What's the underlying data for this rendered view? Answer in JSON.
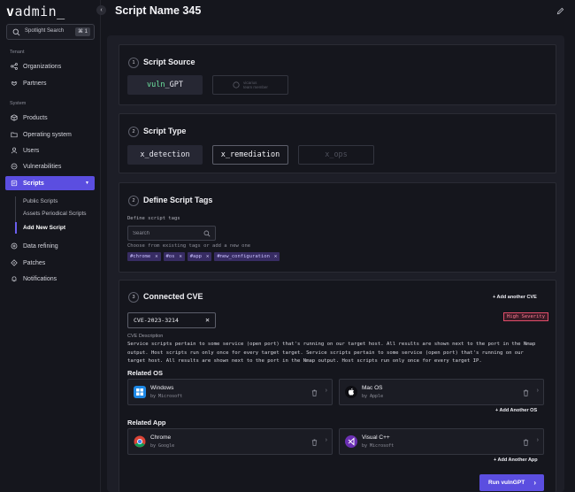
{
  "app": {
    "logo_v": "v",
    "logo_rest": "admin_"
  },
  "spotlight": {
    "label": "Spotlight Search",
    "shortcut": "⌘ 1"
  },
  "sidebar": {
    "sections": [
      "Tenant",
      "System"
    ],
    "tenant_items": [
      {
        "label": "Organizations",
        "icon": "organizations-icon"
      },
      {
        "label": "Partners",
        "icon": "handshake-icon"
      }
    ],
    "system_items": [
      {
        "label": "Products",
        "icon": "box-icon"
      },
      {
        "label": "Operating system",
        "icon": "folder-icon"
      },
      {
        "label": "Users",
        "icon": "users-icon"
      },
      {
        "label": "Vulnerabilities",
        "icon": "shield-icon"
      },
      {
        "label": "Scripts",
        "icon": "scripts-icon",
        "active": true
      },
      {
        "label": "Data refining",
        "icon": "refine-icon"
      },
      {
        "label": "Patches",
        "icon": "patch-icon"
      },
      {
        "label": "Notifications",
        "icon": "bell-icon"
      }
    ],
    "scripts_sub": [
      "Public Scripts",
      "Assets Periodical Scripts",
      "Add New Script"
    ]
  },
  "header": {
    "title": "Script Name 345"
  },
  "script_source": {
    "step": "1",
    "title": "Script Source",
    "option_1_prefix": "vuln",
    "option_1_suffix": "_GPT",
    "option_2_line1": "vicarius",
    "option_2_line2": "team member"
  },
  "script_type": {
    "step": "2",
    "title": "Script Type",
    "options": [
      "x_detection",
      "x_remediation",
      "x_ops"
    ]
  },
  "script_tags": {
    "step": "2",
    "title": "Define Script Tags",
    "label": "Define script tags",
    "search_placeholder": "Search",
    "hint": "Choose from existing tags or add a new one",
    "tags": [
      "#chrome",
      "#os",
      "#app",
      "#new_configuration"
    ],
    "remove_glyph": "✕"
  },
  "cve": {
    "step": "3",
    "title": "Connected CVE",
    "add_label": "+ Add another CVE",
    "id": "CVE-2023-3214",
    "remove_glyph": "✕",
    "severity": "High Severity",
    "desc_label": "CVE Description",
    "description": "Service scripts pertain to some service (open port) that's running on our target host. All results are shown next to the port in the Nmap output. Host scripts run only once for every target target. Service scripts pertain to some service (open port) that's running on our target host. All results are shown next to the port in the Nmap output. Host scripts run only once for every target IP.",
    "related_os_title": "Related OS",
    "related_os": [
      {
        "name": "Windows",
        "by": "by Microsoft",
        "icon": "windows-icon"
      },
      {
        "name": "Mac OS",
        "by": "by Apple",
        "icon": "apple-icon"
      }
    ],
    "add_os_label": "+ Add Another OS",
    "related_app_title": "Related App",
    "related_app": [
      {
        "name": "Chrome",
        "by": "by Google",
        "icon": "chrome-icon"
      },
      {
        "name": "Visual C++",
        "by": "by Microsoft",
        "icon": "visual-cpp-icon"
      }
    ],
    "add_app_label": "+ Add Another App",
    "run_label": "Run vulnGPT",
    "run_arrow": "›"
  },
  "colors": {
    "accent": "#5b4ee0",
    "background": "#15161d",
    "panel": "#1d1e27",
    "severity": "#e14d6a",
    "tag_bg": "#372c63"
  }
}
